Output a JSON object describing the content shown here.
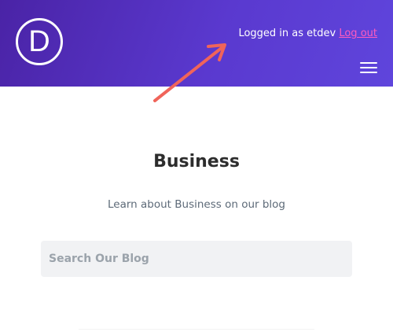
{
  "header": {
    "logo_letter": "D",
    "login_prefix": "Logged in as etdev",
    "logout_label": "Log out",
    "logout_color": "#ff5bbf",
    "gradient_start": "#4a23a6",
    "gradient_end": "#5f45dc",
    "menu_icon": "hamburger-menu-icon"
  },
  "annotation": {
    "arrow_color": "#f0645a"
  },
  "main": {
    "title": "Business",
    "subtitle": "Learn about Business on our blog",
    "search_placeholder": "Search Our Blog"
  }
}
